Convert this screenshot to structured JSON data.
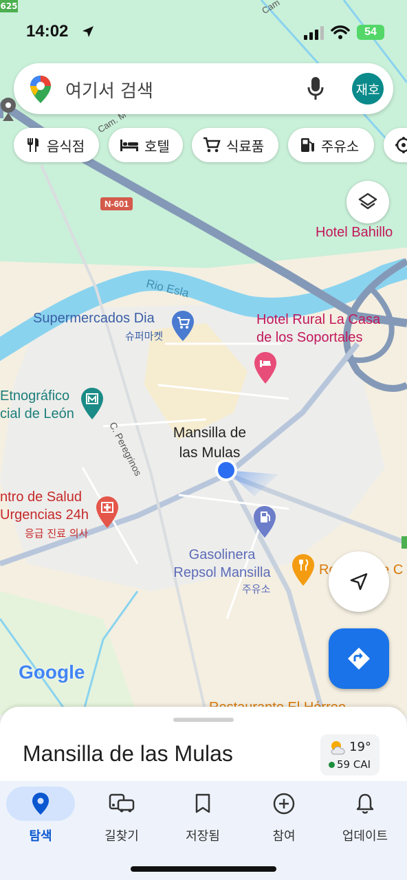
{
  "status_bar": {
    "time": "14:02",
    "battery": "54",
    "colors": {
      "battery": "#53d769"
    }
  },
  "search": {
    "placeholder": "여기서 검색",
    "avatar_text": "재호"
  },
  "chips": [
    {
      "label": "음식점",
      "icon": "restaurant-icon"
    },
    {
      "label": "호텔",
      "icon": "hotel-icon"
    },
    {
      "label": "식료품",
      "icon": "cart-icon"
    },
    {
      "label": "주유소",
      "icon": "gas-icon"
    }
  ],
  "map": {
    "road_labels": {
      "n601": "N-601",
      "cam_m": "Cam. M",
      "cam_top": "Cam",
      "c_peregrinos": "C. Peregrinos",
      "n25": "625"
    },
    "river": "Rio Esla",
    "town": {
      "line1": "Mansilla de",
      "line2": "las Mulas"
    },
    "pois": {
      "hotel_bahillo": "Hotel Bahillo",
      "supermercados": {
        "name": "Supermercados Dia",
        "sub": "슈퍼마켓"
      },
      "hotel_rural": {
        "line1": "Hotel Rural La Casa",
        "line2": "de los Soportales"
      },
      "museo": {
        "line1": "Etnográfico",
        "line2": "cial de León"
      },
      "centro_salud": {
        "line1": "ntro de Salud",
        "line2": "Urgencias 24h",
        "sub": "응급 진료 의사"
      },
      "gasolinera": {
        "line1": "Gasolinera",
        "line2": "Repsol Mansilla",
        "sub": "주유소"
      },
      "restaurante_right": {
        "line1": "Ro",
        "line2": "te C"
      },
      "restaurante_bottom": "Restaurante El Hórreo"
    },
    "google_logo": "Google"
  },
  "sheet": {
    "place_name": "Mansilla de las Mulas",
    "weather": {
      "temp": "19°",
      "aqi": "59 CAI"
    }
  },
  "bottom_nav": [
    {
      "label": "탐색",
      "active": true
    },
    {
      "label": "길찾기",
      "active": false
    },
    {
      "label": "저장됨",
      "active": false
    },
    {
      "label": "참여",
      "active": false
    },
    {
      "label": "업데이트",
      "active": false
    }
  ]
}
